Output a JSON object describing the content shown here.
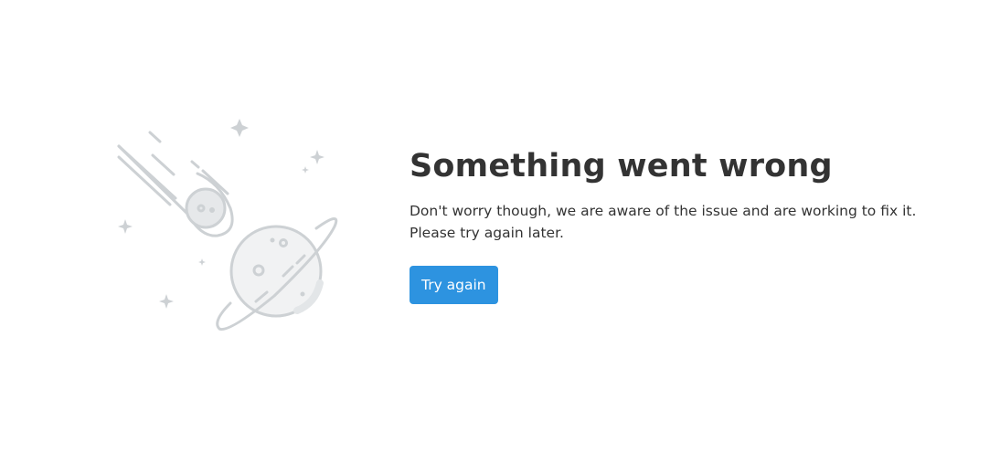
{
  "error": {
    "title": "Something went wrong",
    "message_line_1": "Don't worry though, we are aware of the issue and are working to fix it.",
    "message_line_2": "Please try again later.",
    "retry_label": "Try again"
  },
  "illustration": {
    "icon": "space-meteor-planet-illustration",
    "stroke_color": "#cdd1d4",
    "fill_color": "#f1f2f3"
  },
  "colors": {
    "accent": "#2d93e0",
    "text": "#333333",
    "background": "#ffffff"
  }
}
